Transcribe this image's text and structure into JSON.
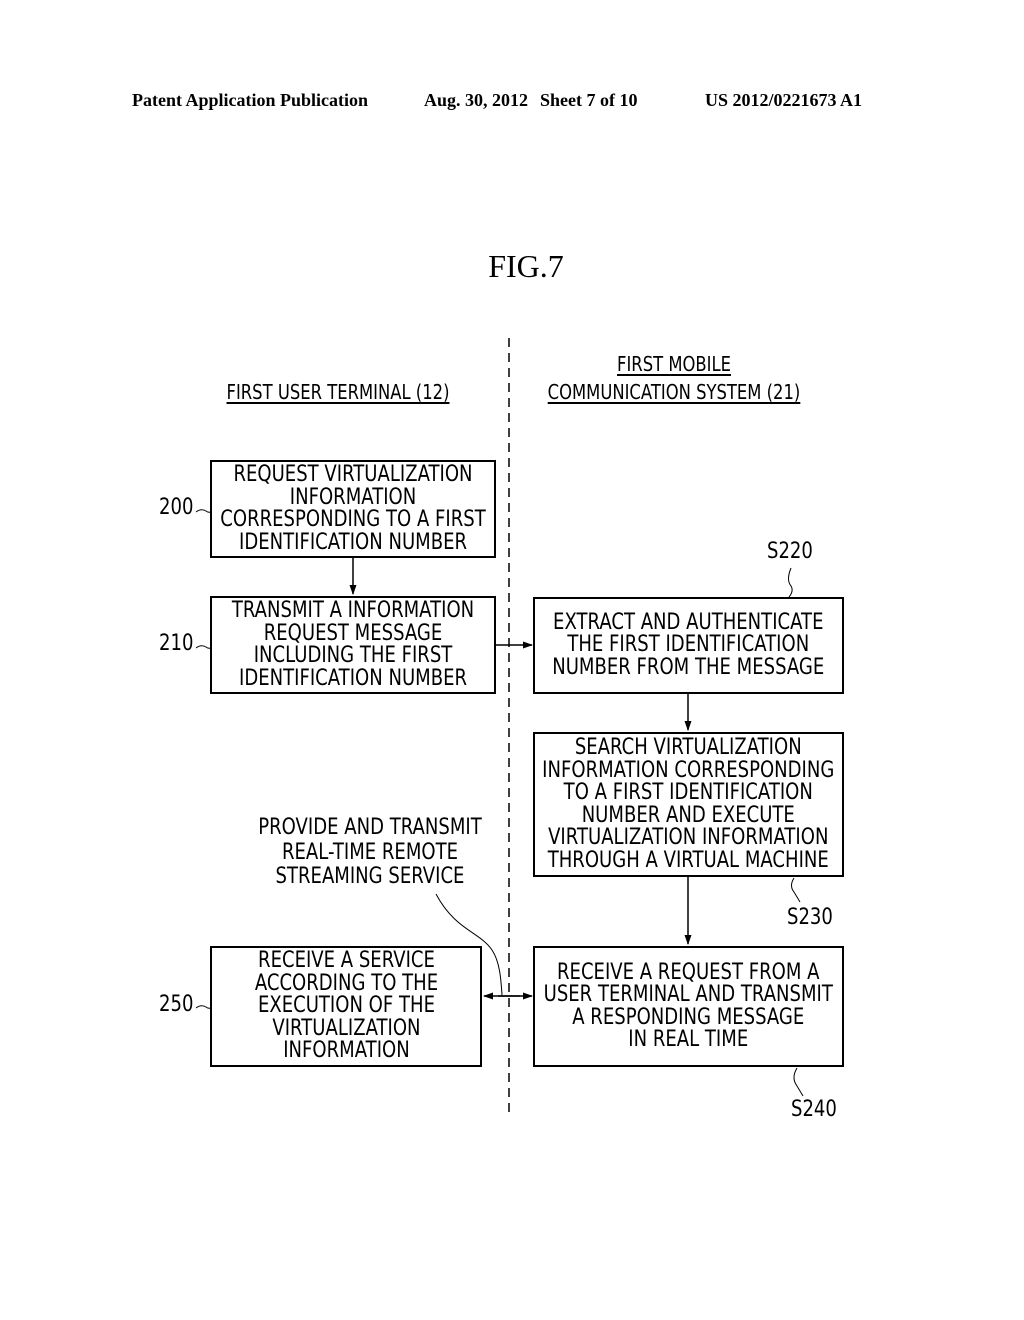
{
  "header": {
    "publication_type": "Patent Application Publication",
    "date": "Aug. 30, 2012",
    "sheet": "Sheet 7 of 10",
    "patent_number": "US 2012/0221673 A1"
  },
  "figure": {
    "title": "FIG.7"
  },
  "lanes": {
    "left": "FIRST USER TERMINAL (12)",
    "right_line1": "FIRST MOBILE",
    "right_line2": "COMMUNICATION SYSTEM (21)"
  },
  "steps": [
    {
      "ref": "200",
      "text": "REQUEST VIRTUALIZATION\nINFORMATION\nCORRESPONDING TO A FIRST\nIDENTIFICATION NUMBER"
    },
    {
      "ref": "210",
      "text": "TRANSMIT A INFORMATION\nREQUEST MESSAGE\nINCLUDING THE FIRST\nIDENTIFICATION NUMBER"
    },
    {
      "ref": "S220",
      "text": "EXTRACT AND AUTHENTICATE\nTHE FIRST IDENTIFICATION\nNUMBER FROM THE MESSAGE"
    },
    {
      "ref": "S230",
      "text": "SEARCH VIRTUALIZATION\nINFORMATION CORRESPONDING\nTO A FIRST IDENTIFICATION\nNUMBER AND EXECUTE\nVIRTUALIZATION INFORMATION\nTHROUGH A VIRTUAL MACHINE"
    },
    {
      "ref": "S240",
      "text": "RECEIVE A REQUEST FROM A\nUSER TERMINAL AND TRANSMIT\nA RESPONDING MESSAGE\nIN REAL TIME"
    },
    {
      "ref": "250",
      "text": "RECEIVE A SERVICE\nACCORDING TO THE\nEXECUTION OF THE\nVIRTUALIZATION\nINFORMATION"
    }
  ],
  "annotation": "PROVIDE AND TRANSMIT\nREAL-TIME REMOTE\nSTREAMING SERVICE"
}
